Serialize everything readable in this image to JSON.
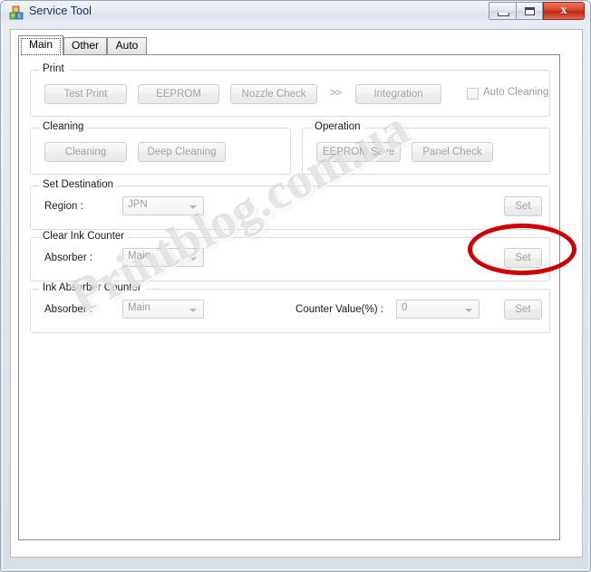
{
  "window": {
    "title": "Service Tool",
    "icon": "app-blocks-icon",
    "controls": {
      "minimize": "minimize-icon",
      "maximize": "maximize-icon",
      "close": "x"
    }
  },
  "tabs": [
    {
      "label": "Main",
      "selected": true
    },
    {
      "label": "Other",
      "selected": false
    },
    {
      "label": "Auto",
      "selected": false
    }
  ],
  "groups": {
    "print": {
      "title": "Print",
      "buttons": [
        {
          "label": "Test Print"
        },
        {
          "label": "EEPROM"
        },
        {
          "label": "Nozzle Check"
        },
        {
          "label": "Integration"
        }
      ],
      "separator": ">>",
      "checkbox": {
        "label": "Auto Cleaning",
        "checked": false
      }
    },
    "cleaning": {
      "title": "Cleaning",
      "buttons": [
        {
          "label": "Cleaning"
        },
        {
          "label": "Deep Cleaning"
        }
      ]
    },
    "operation": {
      "title": "Operation",
      "buttons": [
        {
          "label": "EEPROM Save"
        },
        {
          "label": "Panel Check"
        }
      ]
    },
    "set_destination": {
      "title": "Set Destination",
      "region_label": "Region :",
      "region_value": "JPN",
      "set_label": "Set"
    },
    "clear_ink_counter": {
      "title": "Clear Ink Counter",
      "absorber_label": "Absorber :",
      "absorber_value": "Main",
      "set_label": "Set"
    },
    "ink_absorber_counter": {
      "title": "Ink Absorber Counter",
      "absorber_label": "Absorber :",
      "absorber_value": "Main",
      "counter_label": "Counter Value(%) :",
      "counter_value": "0",
      "set_label": "Set"
    }
  },
  "watermark": {
    "text": "Printblog.com.ua"
  },
  "annotation": {
    "type": "ellipse-highlight",
    "color": "#cc0000",
    "targets": "clear-ink-counter-set-button"
  }
}
